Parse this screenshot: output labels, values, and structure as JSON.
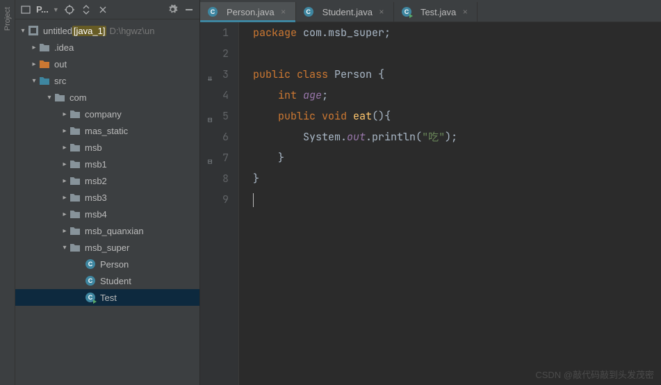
{
  "sidebar": {
    "project_label": "P...",
    "root_name": "untitled",
    "root_module": "[java_1]",
    "root_path": "D:\\hgwz\\un",
    "items": [
      {
        "label": ".idea",
        "type": "folder"
      },
      {
        "label": "out",
        "type": "folder-out"
      },
      {
        "label": "src",
        "type": "folder-src"
      },
      {
        "label": "com",
        "type": "folder"
      },
      {
        "label": "company",
        "type": "folder"
      },
      {
        "label": "mas_static",
        "type": "folder"
      },
      {
        "label": "msb",
        "type": "folder"
      },
      {
        "label": "msb1",
        "type": "folder"
      },
      {
        "label": "msb2",
        "type": "folder"
      },
      {
        "label": "msb3",
        "type": "folder"
      },
      {
        "label": "msb4",
        "type": "folder"
      },
      {
        "label": "msb_quanxian",
        "type": "folder"
      },
      {
        "label": "msb_super",
        "type": "folder"
      },
      {
        "label": "Person",
        "type": "class"
      },
      {
        "label": "Student",
        "type": "class"
      },
      {
        "label": "Test",
        "type": "class-run"
      }
    ]
  },
  "tabs": [
    {
      "label": "Person.java",
      "icon": "class",
      "active": true
    },
    {
      "label": "Student.java",
      "icon": "class",
      "active": false
    },
    {
      "label": "Test.java",
      "icon": "class-run",
      "active": false
    }
  ],
  "code": {
    "lines": [
      {
        "n": 1,
        "html": "<span class='kw'>package</span> <span class='ident'>com.msb_super;</span>"
      },
      {
        "n": 2,
        "html": ""
      },
      {
        "n": 3,
        "html": "<span class='kw'>public class</span> <span class='ident'>Person {</span>"
      },
      {
        "n": 4,
        "html": "    <span class='kw'>int</span> <span class='fld'>age</span><span class='ident'>;</span>"
      },
      {
        "n": 5,
        "html": "    <span class='kw'>public void</span> <span class='fn'>eat</span><span class='ident'>(){</span>"
      },
      {
        "n": 6,
        "html": "        <span class='ident'>System.</span><span class='fld'>out</span><span class='ident'>.println(</span><span class='str'>\"吃\"</span><span class='ident'>);</span>"
      },
      {
        "n": 7,
        "html": "    <span class='ident'>}</span>"
      },
      {
        "n": 8,
        "html": "<span class='ident'>}</span>"
      },
      {
        "n": 9,
        "html": "<span class='caret'></span>"
      }
    ]
  },
  "watermark": "CSDN @敲代码敲到头发茂密"
}
